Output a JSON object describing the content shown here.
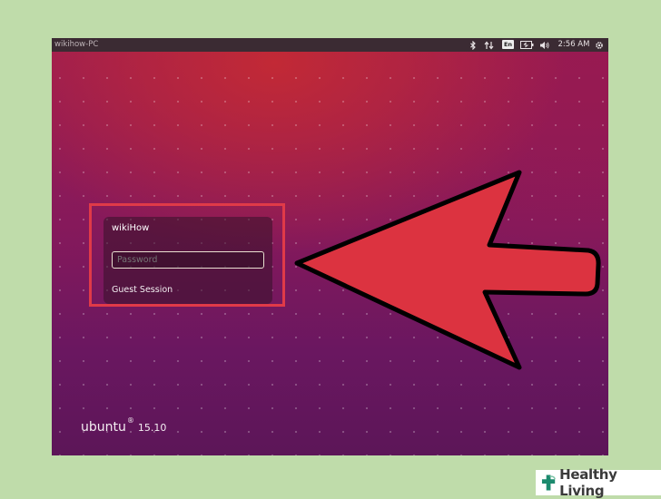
{
  "topbar": {
    "hostname": "wikihow-PC",
    "keyboard_layout": "En",
    "clock": "2:56 AM",
    "icons": [
      "bluetooth-icon",
      "network-icon",
      "battery-icon",
      "volume-icon",
      "gear-icon"
    ]
  },
  "login": {
    "user_name": "wikiHow",
    "password_placeholder": "Password",
    "guest_session_label": "Guest Session"
  },
  "branding": {
    "os_name": "ubuntu",
    "registered_mark": "®",
    "version": "15.10"
  },
  "watermark": {
    "text": "Healthy Living"
  },
  "colors": {
    "page_background": "#bfdcaa",
    "highlight_border": "#e03a48",
    "arrow_fill": "#dc3340",
    "arrow_stroke": "#000000"
  }
}
